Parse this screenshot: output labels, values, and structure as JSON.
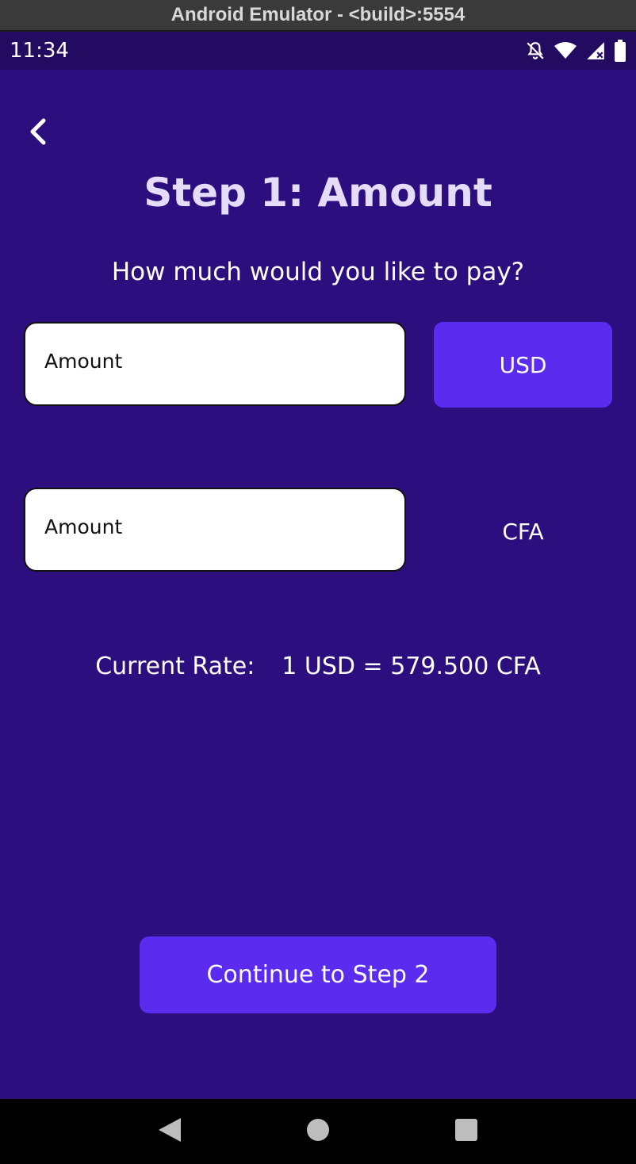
{
  "emulator": {
    "title": "Android Emulator - <build>:5554"
  },
  "status_bar": {
    "time": "11:34",
    "icons": [
      "notifications-off-icon",
      "wifi-icon",
      "signal-icon",
      "battery-icon"
    ]
  },
  "screen": {
    "back_icon": "chevron-left-icon",
    "title": "Step 1: Amount",
    "subtitle": "How much would you like to pay?",
    "source_amount": {
      "placeholder": "Amount",
      "value": ""
    },
    "source_currency": "USD",
    "target_amount": {
      "placeholder": "Amount",
      "value": ""
    },
    "target_currency": "CFA",
    "rate": {
      "label": "Current Rate:",
      "value": "1 USD = 579.500 CFA"
    },
    "continue_label": "Continue to Step 2"
  },
  "nav_bar": {
    "icons": [
      "back-triangle-icon",
      "home-circle-icon",
      "recents-square-icon"
    ]
  },
  "colors": {
    "background": "#2c0e7e",
    "status_bar": "#230b62",
    "accent": "#5b2bf0",
    "title_text": "#e4dcf8"
  }
}
